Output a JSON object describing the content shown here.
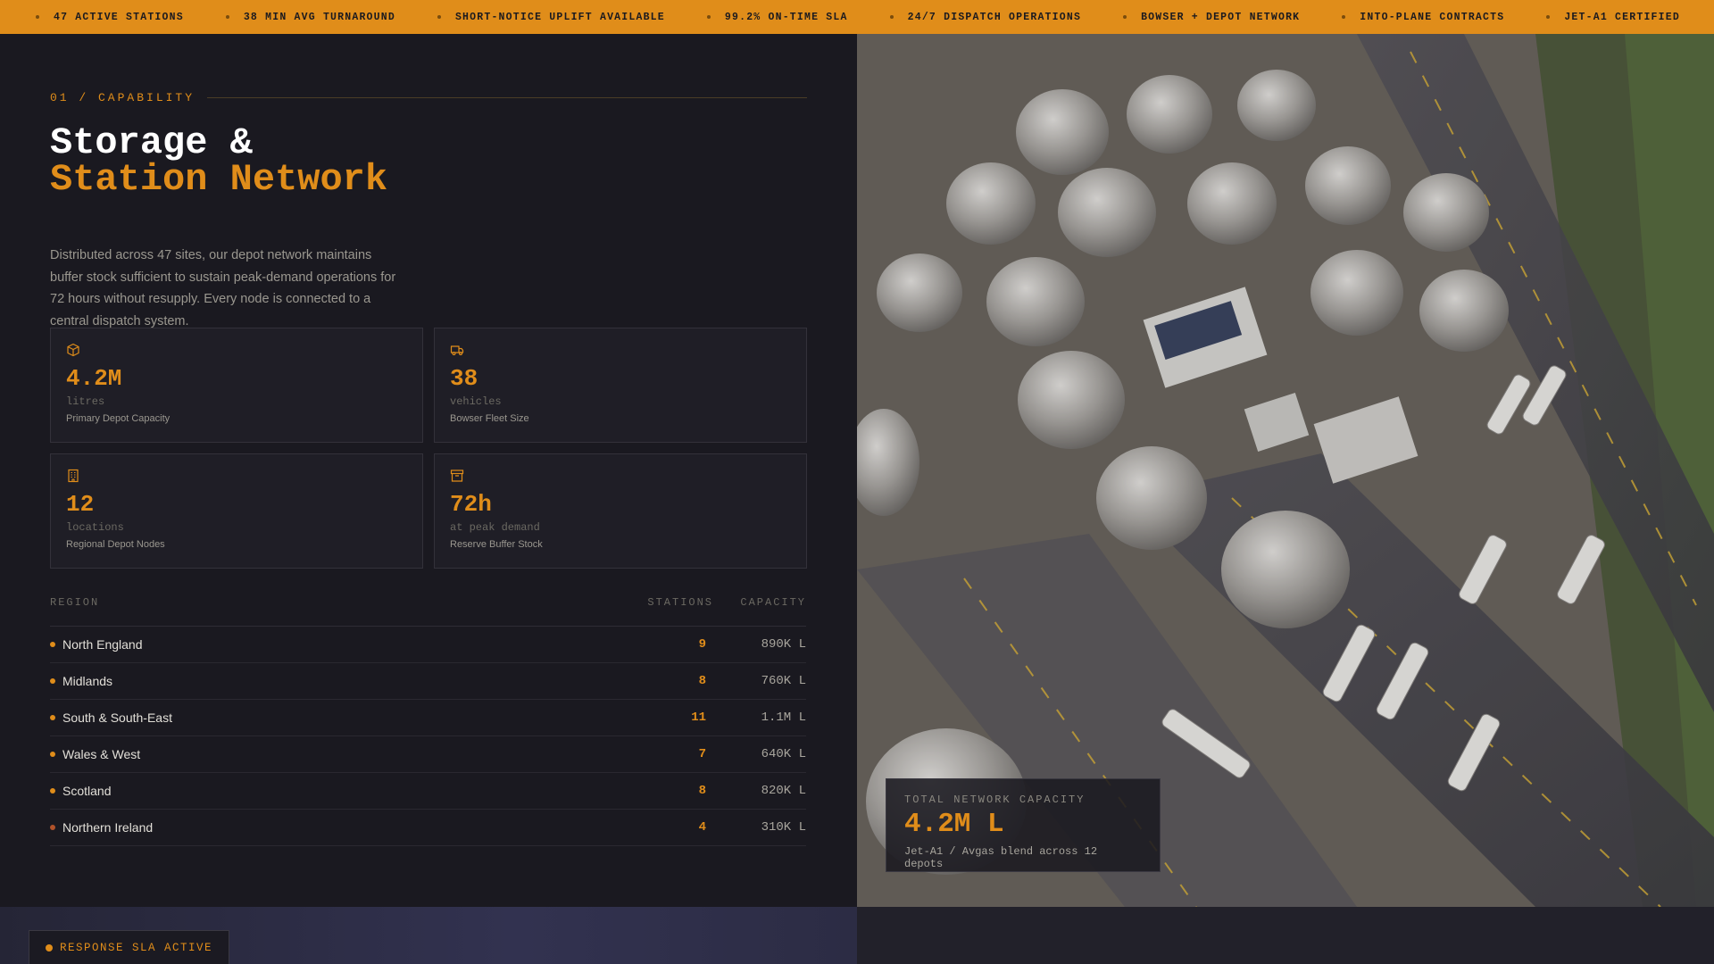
{
  "ticker": {
    "items": [
      "47 ACTIVE STATIONS",
      "38 MIN AVG TURNAROUND",
      "SHORT-NOTICE UPLIFT AVAILABLE",
      "99.2% ON-TIME SLA",
      "24/7 DISPATCH OPERATIONS",
      "BOWSER + DEPOT NETWORK",
      "INTO-PLANE CONTRACTS",
      "JET-A1 CERTIFIED"
    ]
  },
  "section": {
    "eyebrow": "01 / CAPABILITY",
    "title_line1": "Storage &",
    "title_line2": "Station Network",
    "description": "Distributed across 47 sites, our depot network maintains buffer stock sufficient to sustain peak-demand operations for 72 hours without resupply. Every node is connected to a central dispatch system."
  },
  "stats": [
    {
      "icon": "box-icon",
      "value": "4.2M",
      "unit": "litres",
      "label": "Primary Depot Capacity"
    },
    {
      "icon": "truck-icon",
      "value": "38",
      "unit": "vehicles",
      "label": "Bowser Fleet Size"
    },
    {
      "icon": "building-icon",
      "value": "12",
      "unit": "locations",
      "label": "Regional Depot Nodes"
    },
    {
      "icon": "archive-icon",
      "value": "72h",
      "unit": "at peak demand",
      "label": "Reserve Buffer Stock"
    }
  ],
  "table": {
    "headers": {
      "region": "REGION",
      "stations": "STATIONS",
      "capacity": "CAPACITY"
    },
    "rows": [
      {
        "region": "North England",
        "stations": "9",
        "capacity": "890K L"
      },
      {
        "region": "Midlands",
        "stations": "8",
        "capacity": "760K L"
      },
      {
        "region": "South & South-East",
        "stations": "11",
        "capacity": "1.1M L"
      },
      {
        "region": "Wales & West",
        "stations": "7",
        "capacity": "640K L"
      },
      {
        "region": "Scotland",
        "stations": "8",
        "capacity": "820K L"
      },
      {
        "region": "Northern Ireland",
        "stations": "4",
        "capacity": "310K L"
      }
    ]
  },
  "capacity_card": {
    "label": "TOTAL NETWORK CAPACITY",
    "value": "4.2M L",
    "subtitle": "Jet-A1 / Avgas blend across 12 depots"
  },
  "sla_badge": {
    "text": "RESPONSE SLA ACTIVE"
  },
  "colors": {
    "accent": "#e08d1a",
    "background": "#1a1920",
    "card": "#1f1e26"
  }
}
